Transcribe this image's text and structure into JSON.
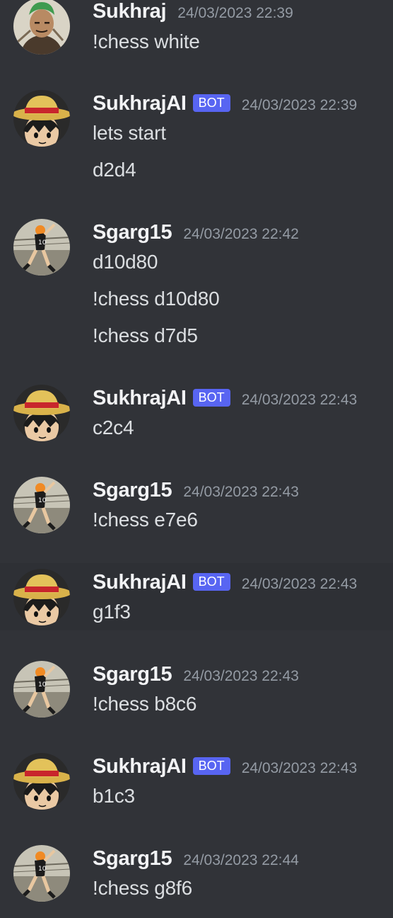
{
  "app": {
    "accent": "#5865f2",
    "background": "#313338",
    "bot_badge": "BOT"
  },
  "messages": [
    {
      "author": "Sukhraj",
      "bot": false,
      "timestamp": "24/03/2023 22:39",
      "lines": [
        "!chess white"
      ],
      "avatar": "zoro-avatar"
    },
    {
      "author": "SukhrajAI",
      "bot": true,
      "timestamp": "24/03/2023 22:39",
      "lines": [
        "lets start",
        "d2d4"
      ],
      "avatar": "luffy-avatar"
    },
    {
      "author": "Sgarg15",
      "bot": false,
      "timestamp": "24/03/2023 22:42",
      "lines": [
        "d10d80",
        "!chess d10d80",
        "!chess d7d5"
      ],
      "avatar": "volleyball-avatar"
    },
    {
      "author": "SukhrajAI",
      "bot": true,
      "timestamp": "24/03/2023 22:43",
      "lines": [
        "c2c4"
      ],
      "avatar": "luffy-avatar"
    },
    {
      "author": "Sgarg15",
      "bot": false,
      "timestamp": "24/03/2023 22:43",
      "lines": [
        "!chess e7e6"
      ],
      "avatar": "volleyball-avatar"
    },
    {
      "author": "SukhrajAI",
      "bot": true,
      "timestamp": "24/03/2023 22:43",
      "lines": [
        "g1f3"
      ],
      "avatar": "luffy-avatar"
    },
    {
      "author": "Sgarg15",
      "bot": false,
      "timestamp": "24/03/2023 22:43",
      "lines": [
        "!chess b8c6"
      ],
      "avatar": "volleyball-avatar"
    },
    {
      "author": "SukhrajAI",
      "bot": true,
      "timestamp": "24/03/2023 22:43",
      "lines": [
        "b1c3"
      ],
      "avatar": "luffy-avatar"
    },
    {
      "author": "Sgarg15",
      "bot": false,
      "timestamp": "24/03/2023 22:44",
      "lines": [
        "!chess g8f6"
      ],
      "avatar": "volleyball-avatar"
    }
  ]
}
